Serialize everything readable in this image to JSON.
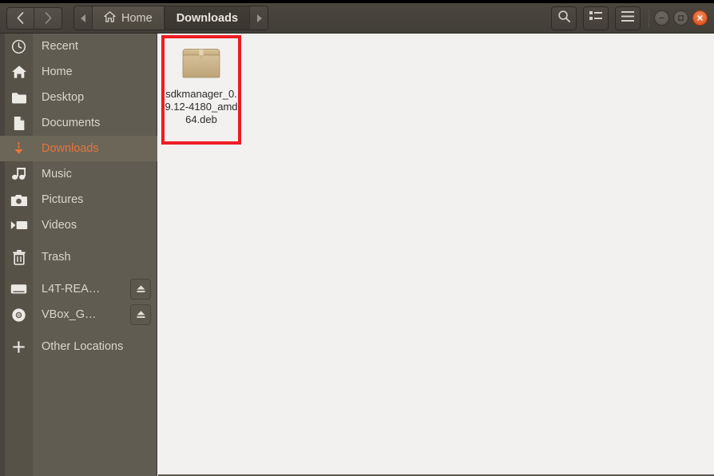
{
  "window": {
    "title": "Downloads",
    "app": "files-nautilus"
  },
  "header": {
    "back_label": "Back",
    "forward_label": "Forward",
    "breadcrumb_prev_label": "Previous path",
    "breadcrumb_next_label": "Next path",
    "crumbs": [
      {
        "label": "Home",
        "icon": "home-icon",
        "active": false
      },
      {
        "label": "Downloads",
        "icon": "",
        "active": true
      }
    ],
    "tools": [
      {
        "name": "search-button",
        "label": "Search",
        "icon": "search-icon"
      },
      {
        "name": "view-options-button",
        "label": "View options",
        "icon": "list-view-icon"
      },
      {
        "name": "menu-button",
        "label": "Menu",
        "icon": "hamburger-icon"
      }
    ],
    "window_controls": [
      {
        "name": "minimize-button",
        "label": "Minimize",
        "glyph": "−"
      },
      {
        "name": "maximize-button",
        "label": "Maximize",
        "glyph": "□"
      },
      {
        "name": "close-button",
        "label": "Close",
        "glyph": "×"
      }
    ]
  },
  "sidebar": {
    "items": [
      {
        "label": "Recent",
        "icon": "clock-icon",
        "selected": false,
        "eject": false
      },
      {
        "label": "Home",
        "icon": "home-icon",
        "selected": false,
        "eject": false
      },
      {
        "label": "Desktop",
        "icon": "folder-icon",
        "selected": false,
        "eject": false
      },
      {
        "label": "Documents",
        "icon": "document-icon",
        "selected": false,
        "eject": false
      },
      {
        "label": "Downloads",
        "icon": "download-icon",
        "selected": true,
        "eject": false
      },
      {
        "label": "Music",
        "icon": "music-icon",
        "selected": false,
        "eject": false
      },
      {
        "label": "Pictures",
        "icon": "camera-icon",
        "selected": false,
        "eject": false
      },
      {
        "label": "Videos",
        "icon": "video-icon",
        "selected": false,
        "eject": false
      },
      {
        "label": "Trash",
        "icon": "trash-icon",
        "selected": false,
        "eject": false
      },
      {
        "label": "L4T-REA…",
        "icon": "drive-icon",
        "selected": false,
        "eject": true
      },
      {
        "label": "VBox_G…",
        "icon": "disc-icon",
        "selected": false,
        "eject": true
      },
      {
        "label": "Other Locations",
        "icon": "plus-icon",
        "selected": false,
        "eject": false
      }
    ]
  },
  "files": [
    {
      "name": "sdkmanager_0.9.12-4180_amd64.deb",
      "icon": "package-icon",
      "highlighted": true
    }
  ],
  "annotation": {
    "highlight_color": "#ed1c24",
    "target": "sdkmanager_0.9.12-4180_amd64.deb"
  },
  "colors": {
    "header_bg": "#453f39",
    "sidebar_bg": "#605c51",
    "sidebar_selected_bg": "#6b6658",
    "accent": "#e8743a",
    "fileview_bg": "#f2f1ef",
    "close_button": "#dd4814"
  }
}
